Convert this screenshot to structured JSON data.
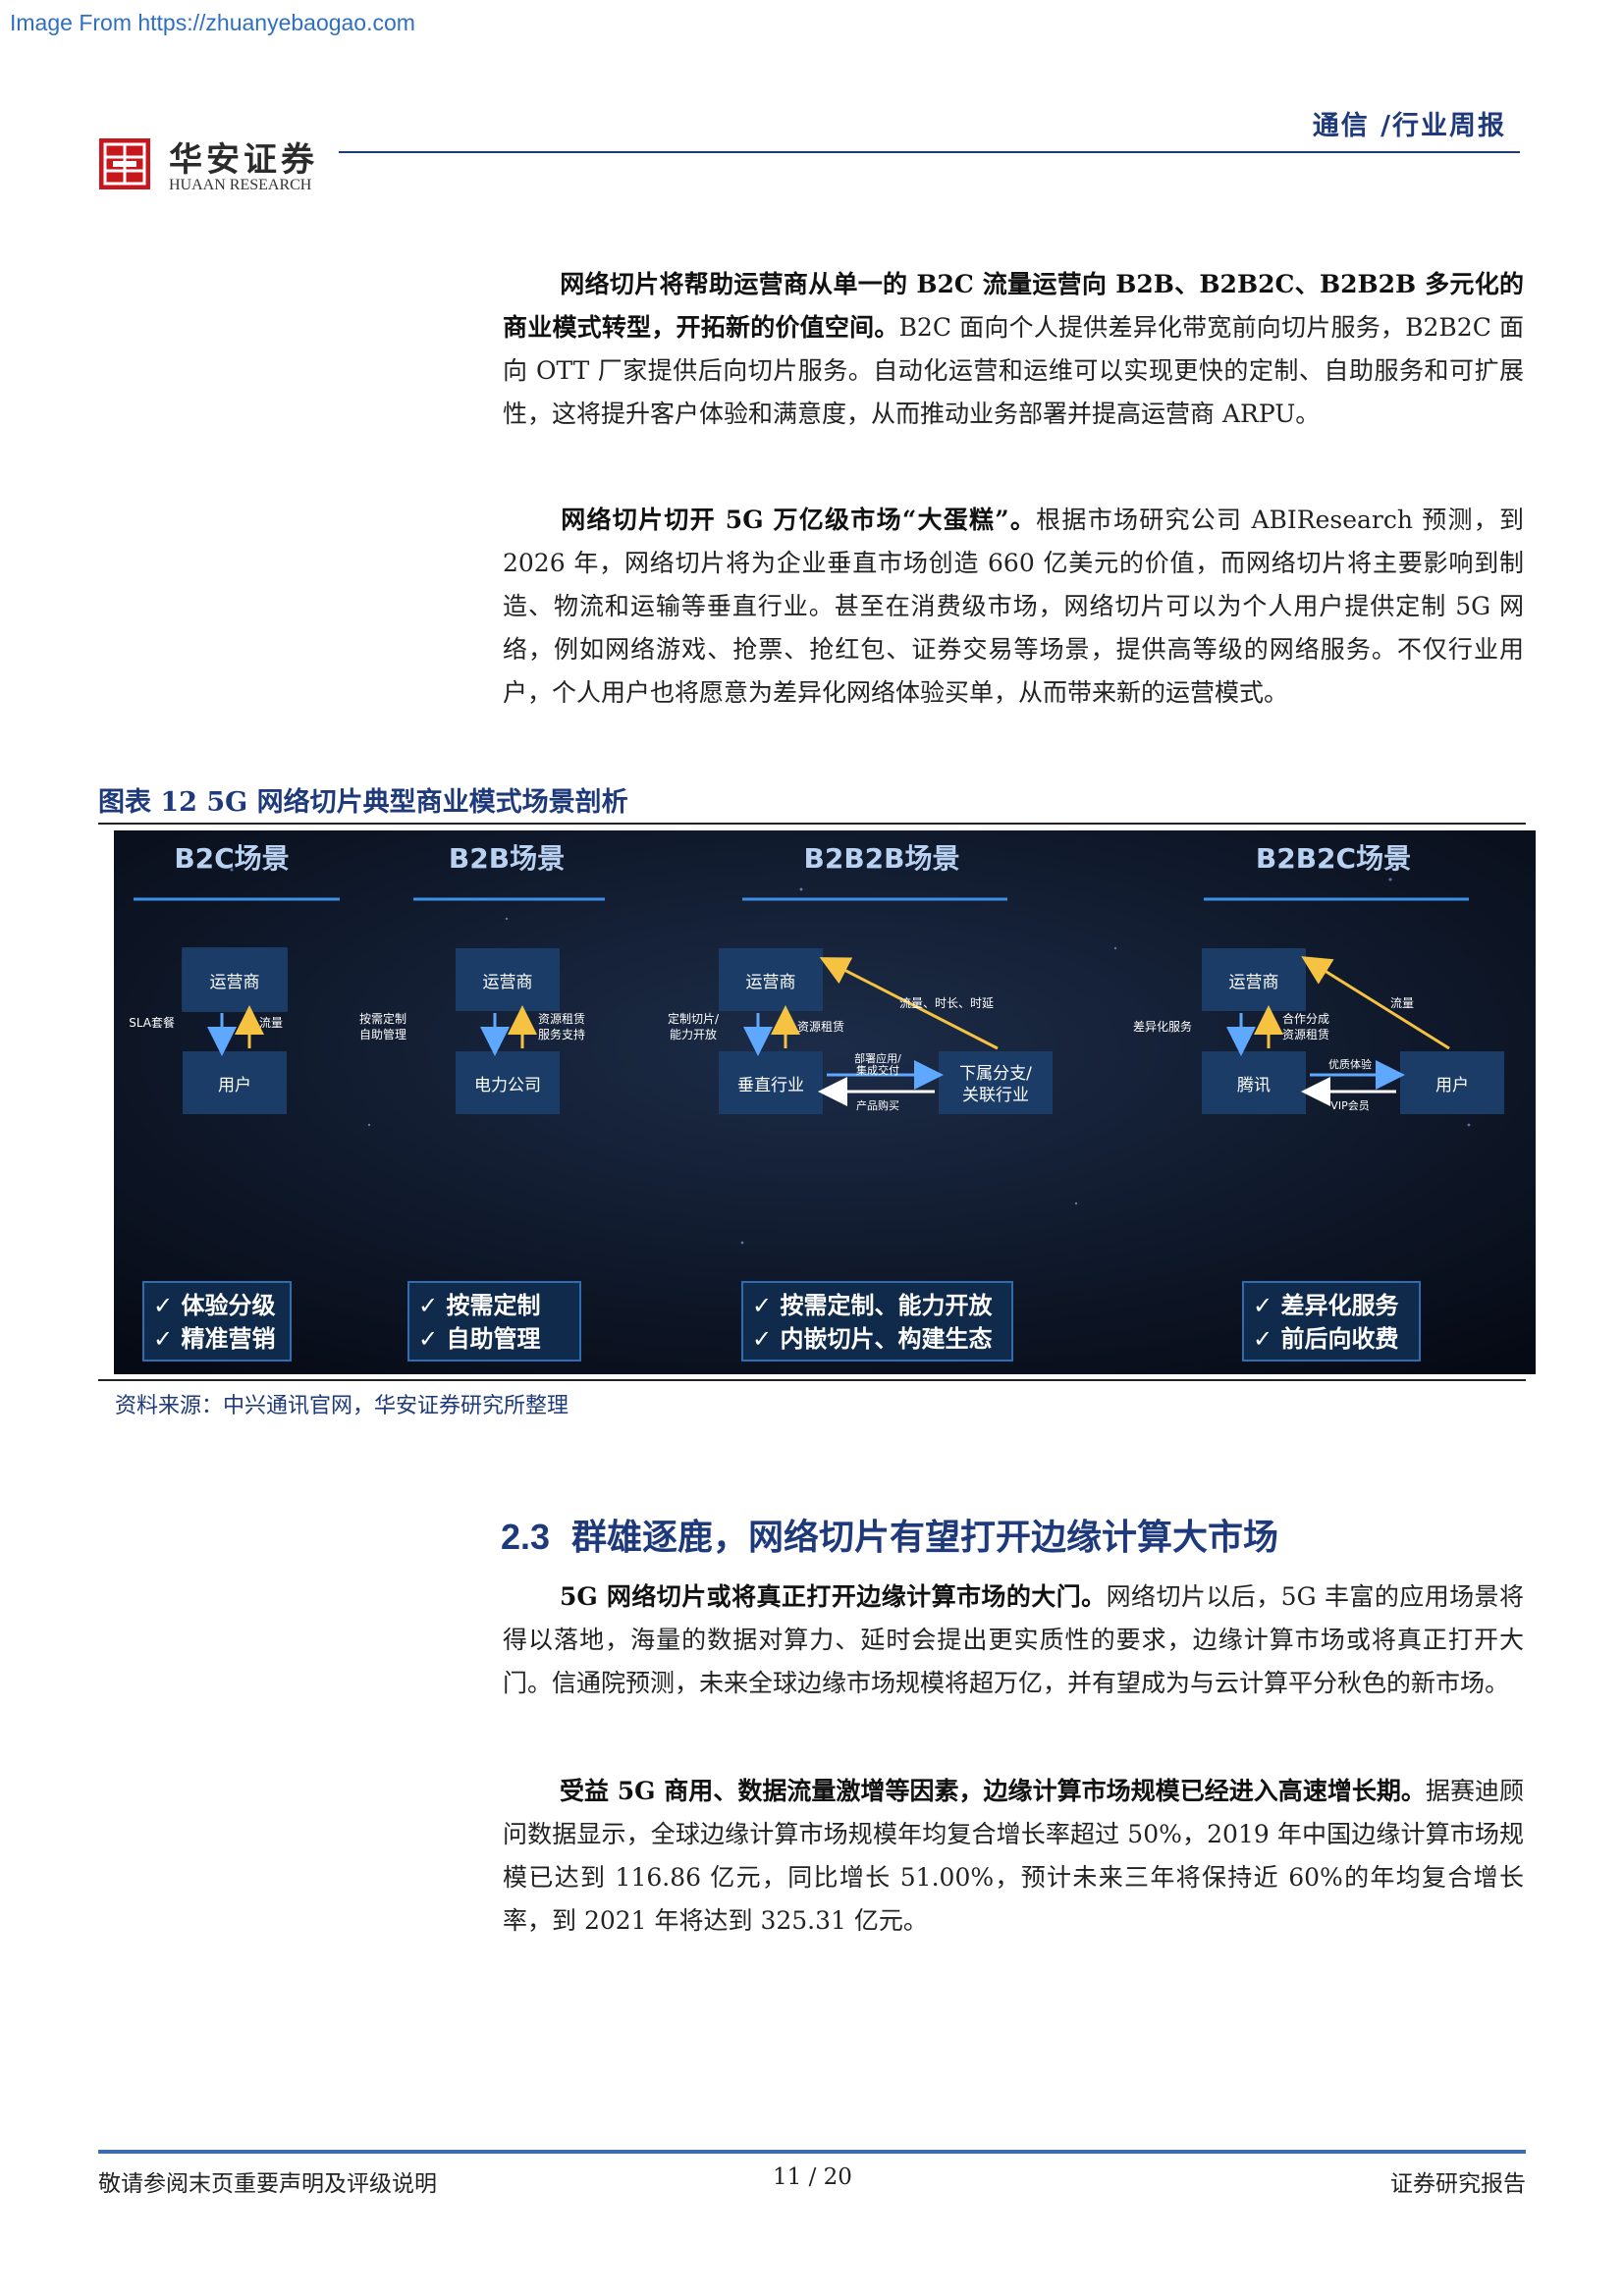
{
  "watermark": "Image From https://zhuanyebaogao.com",
  "header": {
    "logo_cn": "华安证券",
    "logo_en": "HUAAN RESEARCH",
    "title": "通信 /行业周报"
  },
  "paragraphs": [
    {
      "bold": "网络切片将帮助运营商从单一的 B2C 流量运营向 B2B、B2B2C、B2B2B 多元化的商业模式转型，开拓新的价值空间。",
      "text": "B2C 面向个人提供差异化带宽前向切片服务，B2B2C 面向 OTT 厂家提供后向切片服务。自动化运营和运维可以实现更快的定制、自助服务和可扩展性，这将提升客户体验和满意度，从而推动业务部署并提高运营商 ARPU。"
    },
    {
      "bold": "网络切片切开 5G 万亿级市场“大蛋糕”。",
      "text": "根据市场研究公司 ABIResearch 预测，到 2026 年，网络切片将为企业垂直市场创造 660 亿美元的价值，而网络切片将主要影响到制造、物流和运输等垂直行业。甚至在消费级市场，网络切片可以为个人用户提供定制 5G 网络，例如网络游戏、抢票、抢红包、证券交易等场景，提供高等级的网络服务。不仅行业用户，个人用户也将愿意为差异化网络体验买单，从而带来新的运营模式。"
    },
    {
      "bold": "5G 网络切片或将真正打开边缘计算市场的大门。",
      "text": "网络切片以后，5G 丰富的应用场景将得以落地，海量的数据对算力、延时会提出更实质性的要求，边缘计算市场或将真正打开大门。信通院预测，未来全球边缘市场规模将超万亿，并有望成为与云计算平分秋色的新市场。"
    },
    {
      "bold": "受益 5G 商用、数据流量激增等因素，边缘计算市场规模已经进入高速增长期。",
      "text": "据赛迪顾问数据显示，全球边缘计算市场规模年均复合增长率超过 50%，2019 年中国边缘计算市场规模已达到 116.86 亿元，同比增长 51.00%，预计未来三年将保持近 60%的年均复合增长率，到 2021 年将达到 325.31 亿元。"
    }
  ],
  "figure": {
    "title": "图表 12 5G 网络切片典型商业模式场景剖析",
    "source": "资料来源：中兴通讯官网，华安证券研究所整理",
    "panels": [
      {
        "heading": "B2C场景",
        "top": "运营商",
        "bottom": "用户",
        "left_label": "SLA套餐",
        "right_label": "流量",
        "bullets": [
          "体验分级",
          "精准营销"
        ]
      },
      {
        "heading": "B2B场景",
        "top": "运营商",
        "bottom": "电力公司",
        "left_label": "按需定制\n自助管理",
        "right_label": "资源租赁\n服务支持",
        "bullets": [
          "按需定制",
          "自助管理"
        ]
      },
      {
        "heading": "B2B2B场景",
        "top": "运营商",
        "bottom": "垂直行业",
        "side": "下属分支/\n关联行业",
        "left_label": "定制切片/\n能力开放",
        "right_label": "资源租赁",
        "diag_label": "流量、时长、时延",
        "h_top_label": "部署应用/\n集成交付",
        "h_bottom_label": "产品购买",
        "bullets": [
          "按需定制、能力开放",
          "内嵌切片、构建生态"
        ]
      },
      {
        "heading": "B2B2C场景",
        "top": "运营商",
        "bottom": "腾讯",
        "side": "用户",
        "left_label": "差异化服务",
        "right_label": "合作分成\n资源租赁",
        "diag_label": "流量",
        "h_top_label": "优质体验",
        "h_bottom_label": "VIP会员",
        "bullets": [
          "差异化服务",
          "前后向收费"
        ]
      }
    ]
  },
  "section": {
    "number": "2.3",
    "title": "群雄逐鹿，网络切片有望打开边缘计算大市场"
  },
  "footer": {
    "left": "敬请参阅末页重要声明及评级说明",
    "page": "11 / 20",
    "right": "证券研究报告"
  }
}
